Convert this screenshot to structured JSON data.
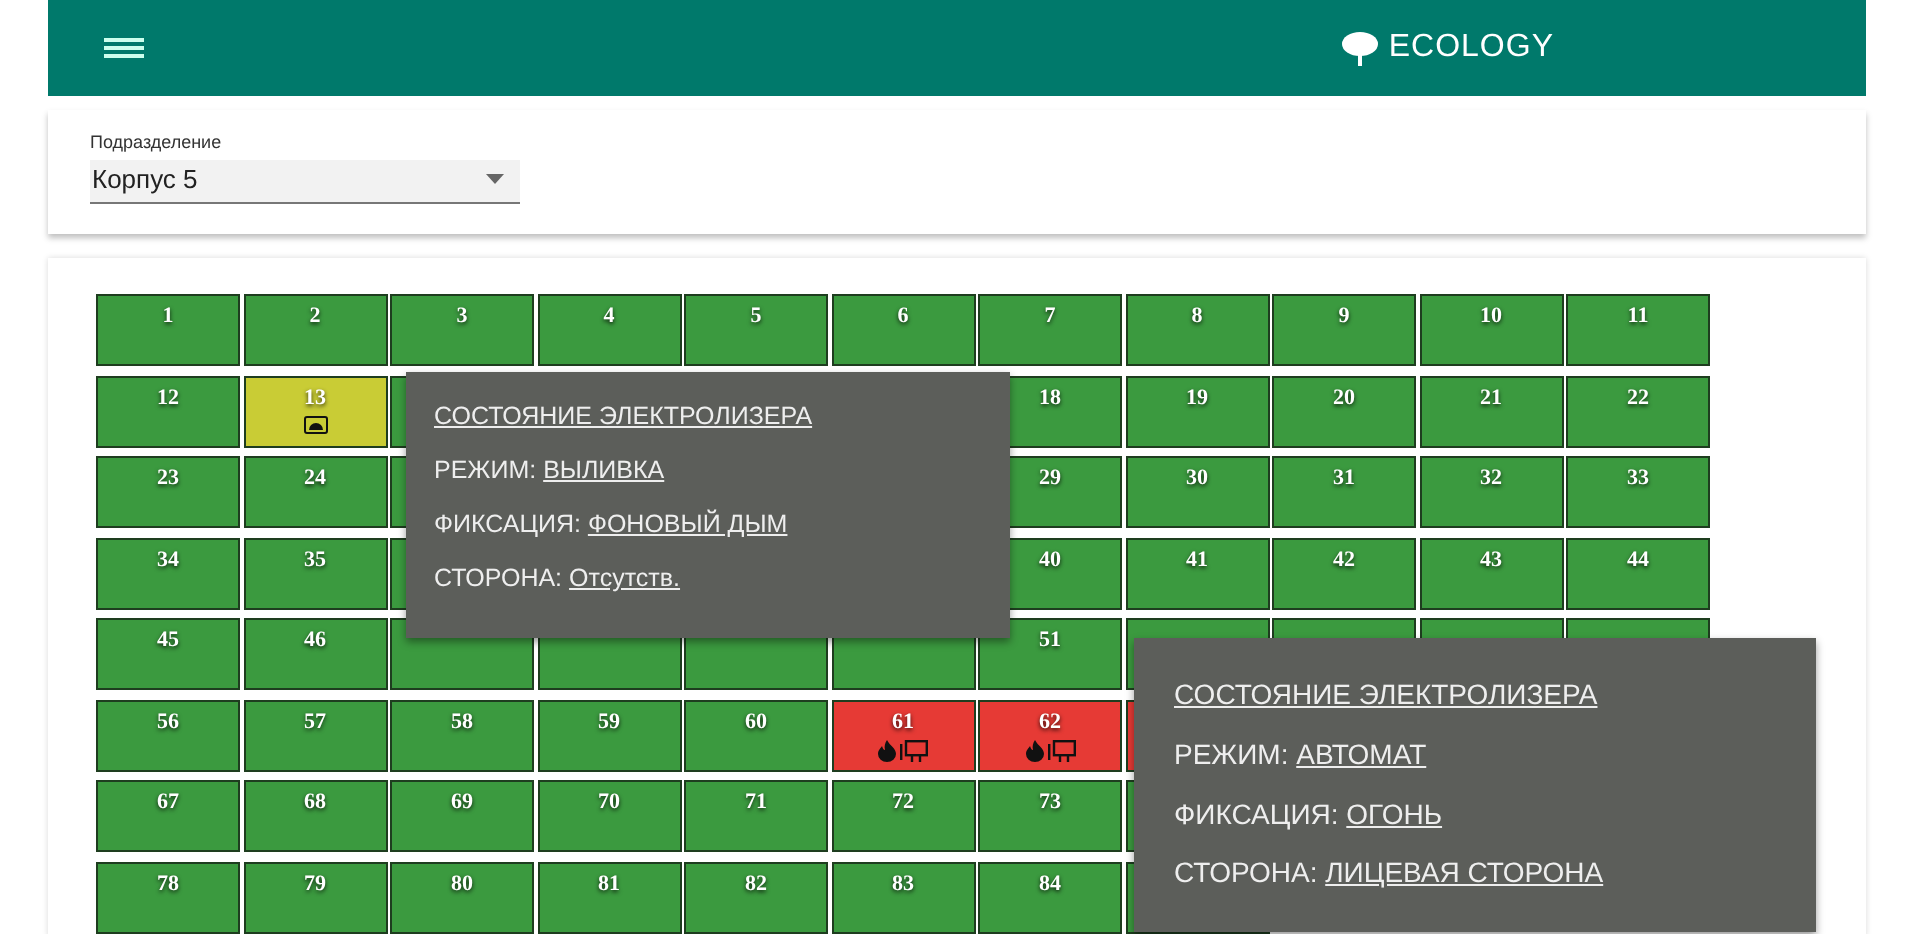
{
  "navbar": {
    "title": "ECOLOGY"
  },
  "filter": {
    "label": "Подразделение",
    "value": "Корпус 5"
  },
  "grid": [
    {
      "segments": [
        [
          {
            "number": "1",
            "kind": "plain",
            "color": "#3b9a3f"
          },
          {
            "number": "2",
            "kind": "plain",
            "color": "#3b9a3f"
          },
          {
            "number": "3",
            "kind": "plain",
            "color": "#3b9a3f"
          },
          {
            "number": "4",
            "kind": "plain",
            "color": "#3b9a3f"
          },
          {
            "number": "5",
            "kind": "plain",
            "color": "#3b9a3f"
          },
          {
            "number": "6",
            "kind": "plain",
            "color": "#3b9a3f"
          },
          {
            "number": "7",
            "kind": "plain",
            "color": "#3b9a3f"
          },
          {
            "number": "8",
            "kind": "plain",
            "color": "#3b9a3f"
          },
          {
            "number": "9",
            "kind": "plain",
            "color": "#3b9a3f"
          },
          {
            "number": "10",
            "kind": "plain",
            "color": "#3b9a3f"
          },
          {
            "number": "11",
            "kind": "plain",
            "color": "#3b9a3f"
          }
        ]
      ]
    },
    {
      "segments": [
        [
          {
            "number": "12",
            "kind": "plain",
            "color": "#3b9a3f"
          },
          {
            "number": "13",
            "kind": "smoke",
            "color": "#c9cc35"
          },
          {
            "kind": "plain",
            "color": "#3b9a3f"
          }
        ],
        [
          {
            "number": "18",
            "kind": "plain",
            "color": "#3b9a3f"
          },
          {
            "number": "19",
            "kind": "plain",
            "color": "#3b9a3f"
          },
          {
            "number": "20",
            "kind": "plain",
            "color": "#3b9a3f"
          },
          {
            "number": "21",
            "kind": "plain",
            "color": "#3b9a3f"
          },
          {
            "number": "22",
            "kind": "plain",
            "color": "#3b9a3f"
          }
        ]
      ]
    },
    {
      "segments": [
        [
          {
            "number": "23",
            "kind": "plain",
            "color": "#3b9a3f"
          },
          {
            "number": "24",
            "kind": "plain",
            "color": "#3b9a3f"
          },
          {
            "kind": "plain",
            "color": "#3b9a3f"
          }
        ],
        [
          {
            "number": "29",
            "kind": "plain",
            "color": "#3b9a3f"
          },
          {
            "number": "30",
            "kind": "plain",
            "color": "#3b9a3f"
          },
          {
            "number": "31",
            "kind": "plain",
            "color": "#3b9a3f"
          },
          {
            "number": "32",
            "kind": "plain",
            "color": "#3b9a3f"
          },
          {
            "number": "33",
            "kind": "plain",
            "color": "#3b9a3f"
          }
        ]
      ]
    },
    {
      "segments": [
        [
          {
            "number": "34",
            "kind": "plain",
            "color": "#3b9a3f"
          },
          {
            "number": "35",
            "kind": "plain",
            "color": "#3b9a3f"
          },
          {
            "kind": "plain",
            "color": "#3b9a3f"
          }
        ],
        [
          {
            "number": "40",
            "kind": "plain",
            "color": "#3b9a3f"
          },
          {
            "number": "41",
            "kind": "plain",
            "color": "#3b9a3f"
          },
          {
            "number": "42",
            "kind": "plain",
            "color": "#3b9a3f"
          },
          {
            "number": "43",
            "kind": "plain",
            "color": "#3b9a3f"
          },
          {
            "number": "44",
            "kind": "plain",
            "color": "#3b9a3f"
          }
        ]
      ]
    },
    {
      "segments": [
        [
          {
            "number": "45",
            "kind": "plain",
            "color": "#3b9a3f"
          },
          {
            "number": "46",
            "kind": "plain",
            "color": "#3b9a3f"
          },
          {
            "kind": "plain",
            "color": "#3b9a3f"
          },
          {
            "kind": "plain",
            "color": "#3b9a3f"
          },
          {
            "kind": "plain",
            "color": "#3b9a3f"
          },
          {
            "kind": "plain",
            "color": "#3b9a3f"
          },
          {
            "number": "51",
            "kind": "plain",
            "color": "#3b9a3f"
          },
          {
            "kind": "plain",
            "color": "#3b9a3f"
          },
          {
            "kind": "plain",
            "color": "#3b9a3f"
          },
          {
            "kind": "plain",
            "color": "#3b9a3f"
          },
          {
            "kind": "plain",
            "color": "#3b9a3f"
          }
        ]
      ]
    },
    {
      "segments": [
        [
          {
            "number": "56",
            "kind": "plain",
            "color": "#3b9a3f"
          },
          {
            "number": "57",
            "kind": "plain",
            "color": "#3b9a3f"
          },
          {
            "number": "58",
            "kind": "plain",
            "color": "#3b9a3f"
          },
          {
            "number": "59",
            "kind": "plain",
            "color": "#3b9a3f"
          },
          {
            "number": "60",
            "kind": "plain",
            "color": "#3b9a3f"
          },
          {
            "number": "61",
            "kind": "fire",
            "color": "#e63a35"
          },
          {
            "number": "62",
            "kind": "fire",
            "color": "#e63a35"
          },
          {
            "kind": "plain",
            "color": "#e63a35"
          }
        ]
      ]
    },
    {
      "segments": [
        [
          {
            "number": "67",
            "kind": "plain",
            "color": "#3b9a3f"
          },
          {
            "number": "68",
            "kind": "plain",
            "color": "#3b9a3f"
          },
          {
            "number": "69",
            "kind": "plain",
            "color": "#3b9a3f"
          },
          {
            "number": "70",
            "kind": "plain",
            "color": "#3b9a3f"
          },
          {
            "number": "71",
            "kind": "plain",
            "color": "#3b9a3f"
          },
          {
            "number": "72",
            "kind": "plain",
            "color": "#3b9a3f"
          },
          {
            "number": "73",
            "kind": "plain",
            "color": "#3b9a3f"
          },
          {
            "kind": "plain",
            "color": "#3b9a3f"
          }
        ]
      ]
    },
    {
      "segments": [
        [
          {
            "number": "78",
            "kind": "plain",
            "color": "#3b9a3f"
          },
          {
            "number": "79",
            "kind": "plain",
            "color": "#3b9a3f"
          },
          {
            "number": "80",
            "kind": "plain",
            "color": "#3b9a3f"
          },
          {
            "number": "81",
            "kind": "plain",
            "color": "#3b9a3f"
          },
          {
            "number": "82",
            "kind": "plain",
            "color": "#3b9a3f"
          },
          {
            "number": "83",
            "kind": "plain",
            "color": "#3b9a3f"
          },
          {
            "number": "84",
            "kind": "plain",
            "color": "#3b9a3f"
          },
          {
            "kind": "plain",
            "color": "#3b9a3f"
          }
        ]
      ]
    }
  ],
  "tooltips": [
    {
      "title": "СОСТОЯНИЕ ЭЛЕКТРОЛИЗЕРА",
      "rows": [
        {
          "label": "РЕЖИМ:",
          "value": "ВЫЛИВКА"
        },
        {
          "label": "ФИКСАЦИЯ:",
          "value": "ФОНОВЫЙ ДЫМ"
        },
        {
          "label": "СТОРОНА:",
          "value": "Отсутств."
        }
      ]
    },
    {
      "title": "СОСТОЯНИЕ ЭЛЕКТРОЛИЗЕРА",
      "rows": [
        {
          "label": "РЕЖИМ:",
          "value": "АВТОМАТ"
        },
        {
          "label": "ФИКСАЦИЯ:",
          "value": "ОГОНЬ"
        },
        {
          "label": "СТОРОНА:",
          "value": "ЛИЦЕВАЯ СТОРОНА"
        }
      ]
    }
  ]
}
